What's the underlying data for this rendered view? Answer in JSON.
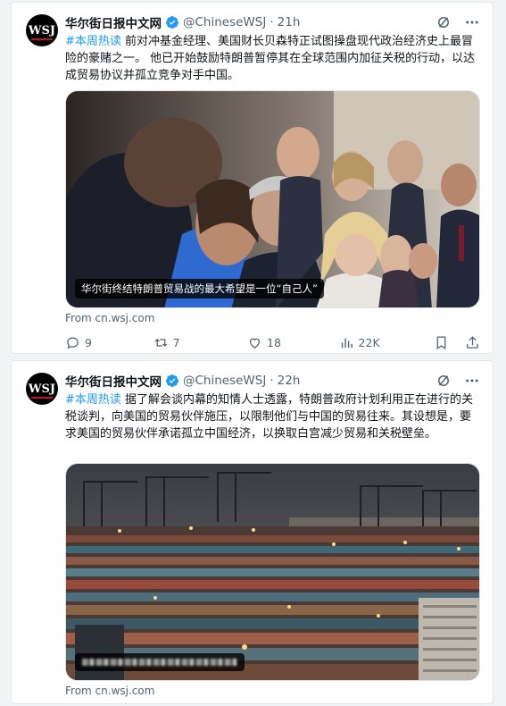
{
  "tweets": [
    {
      "avatar_text": "WSJ",
      "name": "华尔街日报中文网",
      "handle": "@ChineseWSJ",
      "time": "21h",
      "hashtag": "#本周热读",
      "body": " 前对冲基金经理、美国财长贝森特正试图操盘现代政治经济史上最冒险的豪赌之一。 他已开始鼓励特朗普暂停其在全球范围内加征关税的行动，以达成贸易协议并孤立竞争对手中国。",
      "image_caption": "华尔街终结特朗普贸易战的最大希望是一位“自己人”",
      "source": "From cn.wsj.com",
      "stats": {
        "replies": "9",
        "reposts": "7",
        "likes": "18",
        "views": "22K"
      }
    },
    {
      "avatar_text": "WSJ",
      "name": "华尔街日报中文网",
      "handle": "@ChineseWSJ",
      "time": "22h",
      "hashtag": "#本周热读",
      "body": " 据了解会谈内幕的知情人士透露，特朗普政府计划利用正在进行的关税谈判，向美国的贸易伙伴施压，以限制他们与中国的贸易往来。其设想是，要求美国的贸易伙伴承诺孤立中国经济，以换取白宫减少贸易和关税壁垒。",
      "source": "From cn.wsj.com"
    }
  ],
  "colors": {
    "accent": "#1d9bf0",
    "verified": "#1d9bf0",
    "muted": "#536471"
  },
  "icons": [
    "verified-badge-icon",
    "grok-icon",
    "more-icon",
    "reply-icon",
    "repost-icon",
    "like-icon",
    "views-icon",
    "bookmark-icon",
    "share-icon"
  ]
}
